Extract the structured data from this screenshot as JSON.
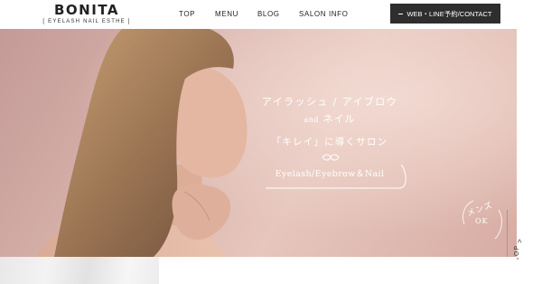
{
  "header": {
    "logo_name": "BONITA",
    "logo_sub": "[ EYELASH NAIL ESTHE ]",
    "nav": [
      "TOP",
      "MENU",
      "BLOG",
      "SALON INFO"
    ],
    "cta_label": "WEB・LINE予約/CONTACT"
  },
  "hero": {
    "line1": "アイラッシュ / アイブロウ",
    "line2_and": "and",
    "line2_word": "ネイル",
    "line3": "「キレイ」に導くサロン",
    "line4": "Eyelash/Eyebrow＆Nail",
    "mens_line1": "メンズ",
    "mens_line2": "OK"
  },
  "side": {
    "to_top_label": "TOP",
    "to_top_arrow": ">"
  },
  "colors": {
    "cta_background": "#2e2e2e",
    "hero_pink": "#d9b4ad",
    "hero_text": "#ffffff"
  }
}
